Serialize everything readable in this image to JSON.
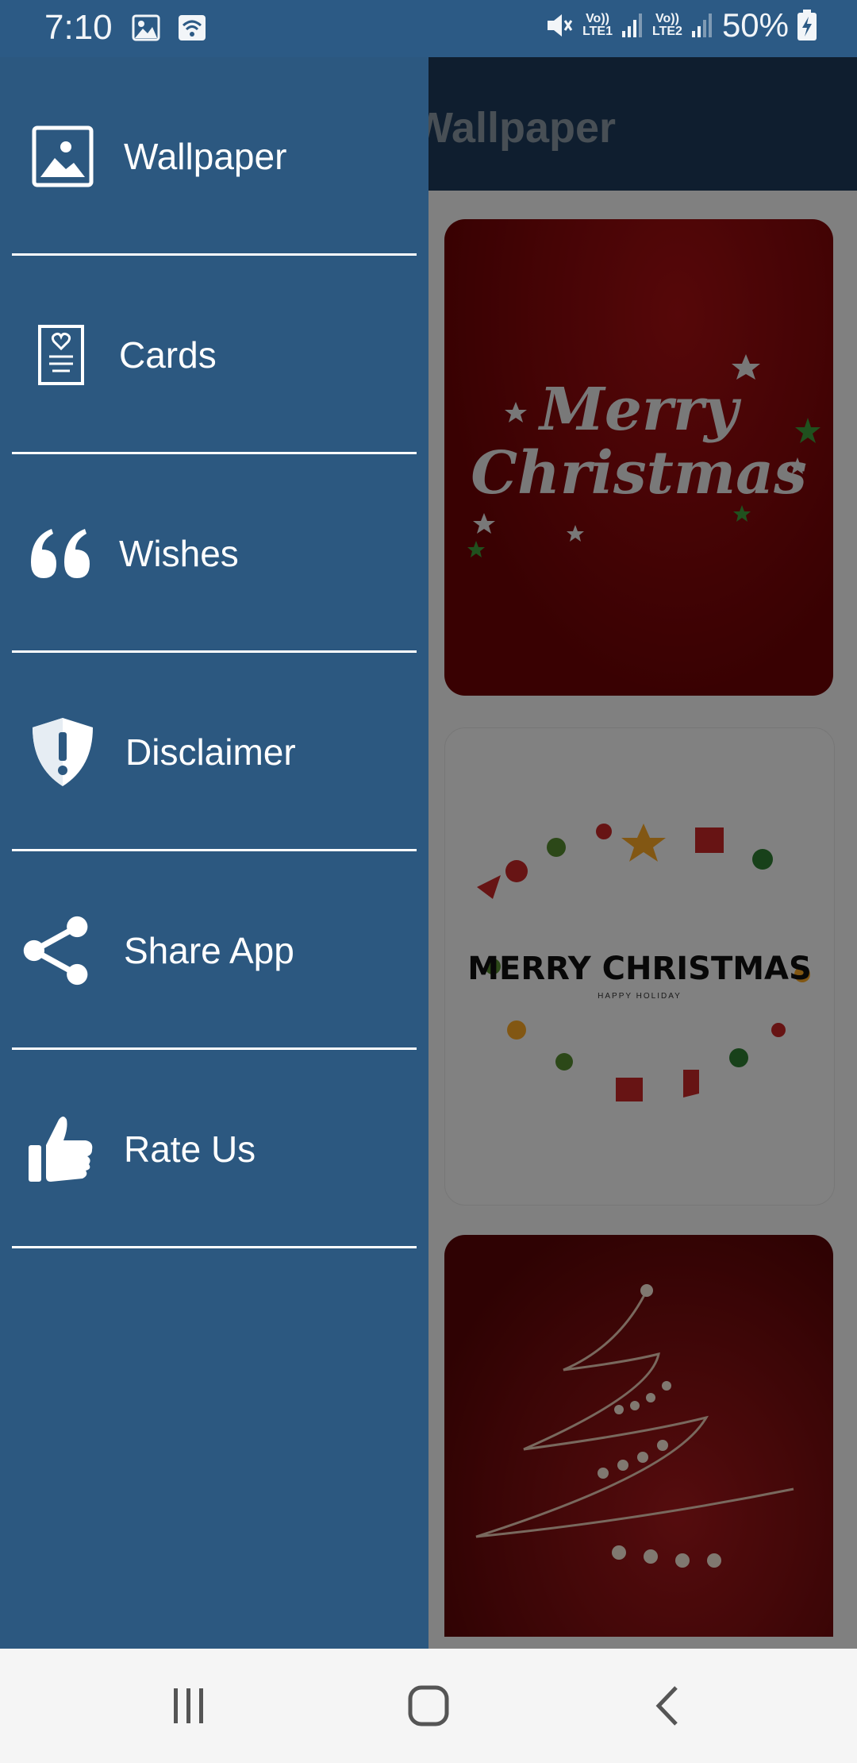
{
  "status_bar": {
    "time": "7:10",
    "battery": "50%",
    "sim1": "LTE1",
    "sim2": "LTE2",
    "volte": "Vo))",
    "left_icons": [
      "image-icon",
      "wifi-icon"
    ],
    "right_icons": [
      "mute-icon",
      "signal-icon",
      "battery-charging-icon"
    ]
  },
  "app": {
    "title": "Wallpaper",
    "cards": [
      {
        "text": "Merry Christmas"
      },
      {
        "text": "MERRY CHRISTMAS",
        "subtext": "HAPPY HOLIDAY"
      },
      {
        "text": ""
      }
    ]
  },
  "drawer": {
    "items": [
      {
        "label": "Wallpaper",
        "icon": "image-icon"
      },
      {
        "label": "Cards",
        "icon": "card-heart-icon"
      },
      {
        "label": "Wishes",
        "icon": "quote-icon"
      },
      {
        "label": "Disclaimer",
        "icon": "shield-alert-icon"
      },
      {
        "label": "Share App",
        "icon": "share-icon"
      },
      {
        "label": "Rate Us",
        "icon": "thumbs-up-icon"
      }
    ]
  },
  "nav_bar": {
    "buttons": [
      "recents-icon",
      "home-icon",
      "back-icon"
    ]
  },
  "colors": {
    "drawer": "#2c5880",
    "status_bar": "#2c5a85",
    "header": "#1d3b5a"
  }
}
